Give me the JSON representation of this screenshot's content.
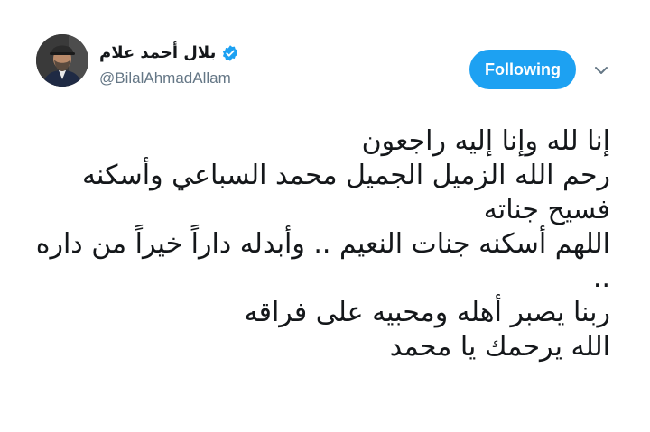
{
  "tweet": {
    "author": {
      "display_name": "بلال أحمد علام",
      "handle": "@BilalAhmadAllam",
      "verified": true,
      "avatar_icon": "profile-photo"
    },
    "follow_button_label": "Following",
    "accent_color": "#1da1f2",
    "text_lines": [
      "إنا لله وإنا إليه راجعون",
      "رحم الله الزميل الجميل محمد السباعي وأسكنه",
      "فسيح جناته",
      "اللهم أسكنه جنات النعيم .. وأبدله داراً خيراً من داره",
      "..",
      "ربنا يصبر أهله ومحبيه على فراقه",
      "الله يرحمك يا محمد"
    ]
  }
}
